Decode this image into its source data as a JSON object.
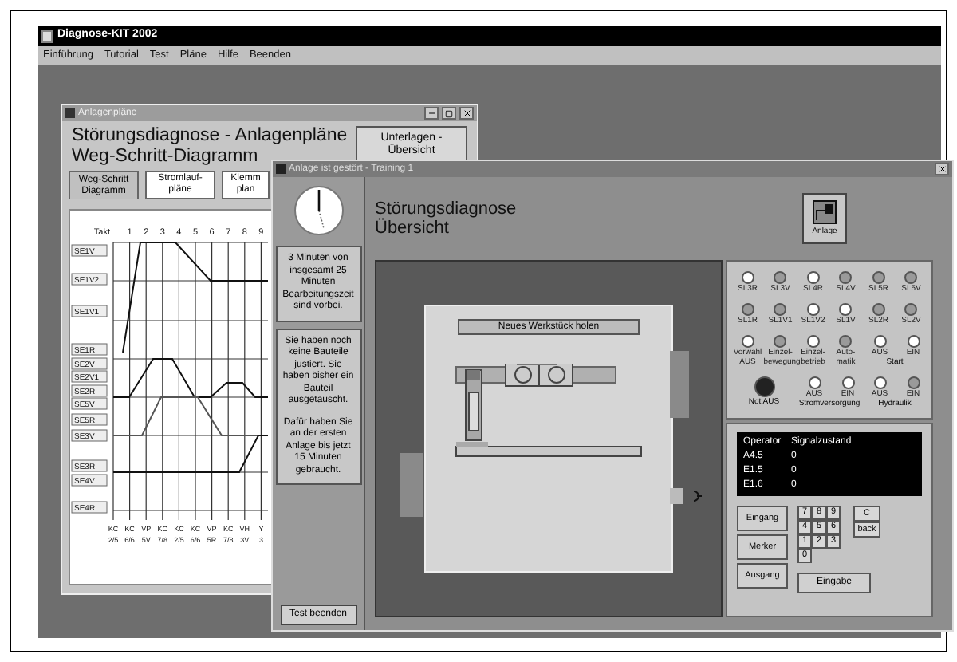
{
  "main_window": {
    "title": "Diagnose-KIT 2002",
    "menu": [
      "Einführung",
      "Tutorial",
      "Test",
      "Pläne",
      "Hilfe",
      "Beenden"
    ]
  },
  "plans_window": {
    "title": "Anlagenpläne",
    "heading": [
      "Störungsdiagnose - Anlagenpläne",
      "Weg-Schritt-Diagramm"
    ],
    "docs_button": "Unterlagen - Übersicht",
    "tabs": [
      {
        "label": "Weg-Schritt Diagramm",
        "selected": true
      },
      {
        "label": "Stromlauf- pläne",
        "selected": false
      },
      {
        "label": "Klemm plan",
        "selected": false
      }
    ],
    "diagram": {
      "step_header": "Takt",
      "steps": [
        "1",
        "2",
        "3",
        "4",
        "5",
        "6",
        "7",
        "8",
        "9"
      ],
      "rows": [
        "SE1V",
        "SE1V2",
        "SE1V1",
        "SE1R",
        "SE2V",
        "SE2V1",
        "SE2R",
        "SE5V",
        "SE5R",
        "SE3V",
        "SE3R",
        "SE4V",
        "SE4R"
      ],
      "bottom_labels": [
        [
          "KC",
          "2/5"
        ],
        [
          "KC",
          "6/6"
        ],
        [
          "VP",
          "5V"
        ],
        [
          "KC",
          "7/8"
        ],
        [
          "KC",
          "2/5"
        ],
        [
          "KC",
          "6/6"
        ],
        [
          "VP",
          "5R"
        ],
        [
          "KC",
          "7/8"
        ],
        [
          "VH",
          "3V"
        ],
        [
          "Y",
          "3"
        ]
      ]
    }
  },
  "training_window": {
    "title": "Anlage ist gestört - Training 1",
    "time_note": "3 Minuten von insgesamt 25 Minuten Bearbeitungszeit sind vorbei.",
    "progress_notes": [
      "Sie haben noch keine Bauteile justiert. Sie haben bisher ein Bauteil ausgetauscht.",
      "Dafür haben Sie an der ersten Anlage bis jetzt 15 Minuten gebraucht."
    ],
    "end_button": "Test beenden",
    "heading": [
      "Störungsdiagnose",
      "Übersicht"
    ],
    "plant_button": "Anlage",
    "new_part_button": "Neues Werkstück holen",
    "indicator_rows": [
      [
        {
          "label": "SL3R",
          "on": true
        },
        {
          "label": "SL3V",
          "on": false
        },
        {
          "label": "SL4R",
          "on": true
        },
        {
          "label": "SL4V",
          "on": false
        },
        {
          "label": "SL5R",
          "on": false
        },
        {
          "label": "SL5V",
          "on": false
        }
      ],
      [
        {
          "label": "SL1R",
          "on": false
        },
        {
          "label": "SL1V1",
          "on": false
        },
        {
          "label": "SL1V2",
          "on": true
        },
        {
          "label": "SL1V",
          "on": true
        },
        {
          "label": "SL2R",
          "on": false
        },
        {
          "label": "SL2V",
          "on": false
        }
      ]
    ],
    "mode_switches": [
      {
        "label": "Vorwahl AUS",
        "on": true
      },
      {
        "label": "Einzel- bewegung",
        "on": false
      },
      {
        "label": "Einzel- betrieb",
        "on": true
      },
      {
        "label": "Auto- matik",
        "on": false
      }
    ],
    "start_group": {
      "label": "Start",
      "switches": [
        {
          "label": "AUS",
          "on": true
        },
        {
          "label": "EIN",
          "on": true
        }
      ]
    },
    "emergency_stop": {
      "label": "Not AUS"
    },
    "power_groups": [
      {
        "label": "Stromversorgung",
        "switches": [
          {
            "label": "AUS",
            "on": true
          },
          {
            "label": "EIN",
            "on": true
          }
        ]
      },
      {
        "label": "Hydraulik",
        "switches": [
          {
            "label": "AUS",
            "on": true
          },
          {
            "label": "EIN",
            "on": false
          }
        ]
      }
    ],
    "display": {
      "headers": [
        "Operator",
        "Signalzustand"
      ],
      "rows": [
        [
          "A4.5",
          "0"
        ],
        [
          "E1.5",
          "0"
        ],
        [
          "E1.6",
          "0"
        ]
      ]
    },
    "operand_buttons": [
      "Eingang",
      "Merker",
      "Ausgang"
    ],
    "keypad": [
      "7",
      "8",
      "9",
      "4",
      "5",
      "6",
      "1",
      "2",
      "3",
      "0"
    ],
    "clear_keys": [
      "C",
      "back"
    ],
    "enter_button": "Eingabe"
  }
}
